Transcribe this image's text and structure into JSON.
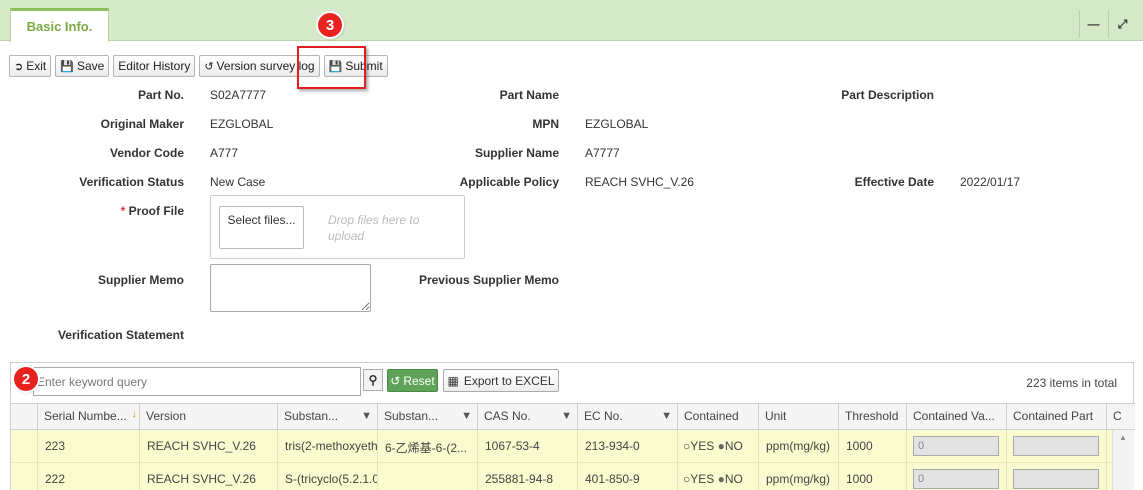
{
  "tab": {
    "label": "Basic Info."
  },
  "window": {
    "minimize_icon": "minimize-icon",
    "maximize_icon": "maximize-icon"
  },
  "toolbar": {
    "exit_label": "Exit",
    "save_label": "Save",
    "editor_history_label": "Editor History",
    "version_survey_log_label": "Version survey log",
    "submit_label": "Submit"
  },
  "badges": {
    "submit_step": "3",
    "search_step": "2"
  },
  "form": {
    "part_no": {
      "label": "Part No.",
      "value": "S02A7777"
    },
    "part_name": {
      "label": "Part Name",
      "value": ""
    },
    "part_description": {
      "label": "Part Description",
      "value": ""
    },
    "original_maker": {
      "label": "Original Maker",
      "value": "EZGLOBAL"
    },
    "mpn": {
      "label": "MPN",
      "value": "EZGLOBAL"
    },
    "vendor_code": {
      "label": "Vendor Code",
      "value": "A777"
    },
    "supplier_name": {
      "label": "Supplier Name",
      "value": "A7777"
    },
    "verification_status": {
      "label": "Verification Status",
      "value": "New Case"
    },
    "applicable_policy": {
      "label": "Applicable Policy",
      "value": "REACH SVHC_V.26"
    },
    "effective_date": {
      "label": "Effective Date",
      "value": "2022/01/17"
    },
    "proof_file": {
      "required_mark": "*",
      "label": "Proof File",
      "select_label": "Select files...",
      "drop_hint": "Drop files here to upload"
    },
    "supplier_memo": {
      "label": "Supplier Memo"
    },
    "previous_supplier_memo": {
      "label": "Previous Supplier Memo"
    },
    "verification_statement": {
      "label": "Verification Statement"
    }
  },
  "grid": {
    "search_placeholder": "Enter keyword query",
    "reset_label": "Reset",
    "export_label": "Export to EXCEL",
    "count_text": "223 items in total",
    "columns": [
      "Serial Numbe...",
      "Version",
      "Substan...",
      "Substan...",
      "CAS No.",
      "EC No.",
      "Contained",
      "Unit",
      "Threshold",
      "Contained Va...",
      "Contained Part",
      "C"
    ],
    "rows": [
      {
        "serial": "223",
        "version": "REACH SVHC_V.26",
        "substance1": "tris(2-methoxyeth",
        "substance2": "6-乙烯基-6-(2...",
        "cas": "1067-53-4",
        "ec": "213-934-0",
        "yes": "YES",
        "no": "NO",
        "unit": "ppm(mg/kg)",
        "threshold": "1000",
        "contained_value": "0"
      },
      {
        "serial": "222",
        "version": "REACH SVHC_V.26",
        "substance1": "S-(tricyclo(5.2.1.0",
        "substance2": "",
        "cas": "255881-94-8",
        "ec": "401-850-9",
        "yes": "YES",
        "no": "NO",
        "unit": "ppm(mg/kg)",
        "threshold": "1000",
        "contained_value": "0"
      }
    ]
  },
  "colors": {
    "accent_green": "#5fa35a",
    "tab_bar": "#d5e8c8",
    "highlight_red": "#e02020",
    "row_yellow": "#fbfbd0"
  }
}
